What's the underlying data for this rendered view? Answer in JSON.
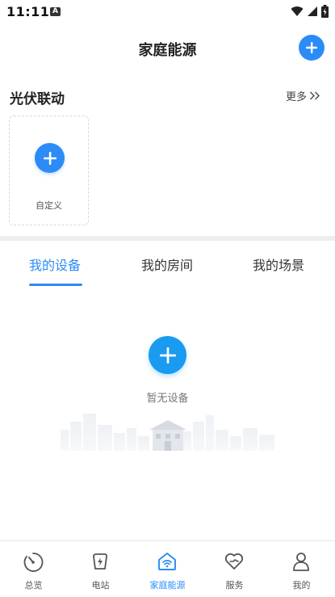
{
  "status_bar": {
    "time": "11:11",
    "badge": "A"
  },
  "header": {
    "title": "家庭能源"
  },
  "pv_section": {
    "title": "光伏联动",
    "more_label": "更多",
    "custom_label": "自定义"
  },
  "tabs": [
    {
      "label": "我的设备",
      "active": true
    },
    {
      "label": "我的房间",
      "active": false
    },
    {
      "label": "我的场景",
      "active": false
    }
  ],
  "empty_state": {
    "text": "暂无设备"
  },
  "bottom_nav": [
    {
      "label": "总览",
      "icon": "dashboard-icon",
      "active": false
    },
    {
      "label": "电站",
      "icon": "power-station-icon",
      "active": false
    },
    {
      "label": "家庭能源",
      "icon": "home-energy-icon",
      "active": true
    },
    {
      "label": "服务",
      "icon": "heart-service-icon",
      "active": false
    },
    {
      "label": "我的",
      "icon": "person-icon",
      "active": false
    }
  ],
  "colors": {
    "accent": "#2b8cf7",
    "inactive": "#555555",
    "divider": "#eeeeee"
  }
}
